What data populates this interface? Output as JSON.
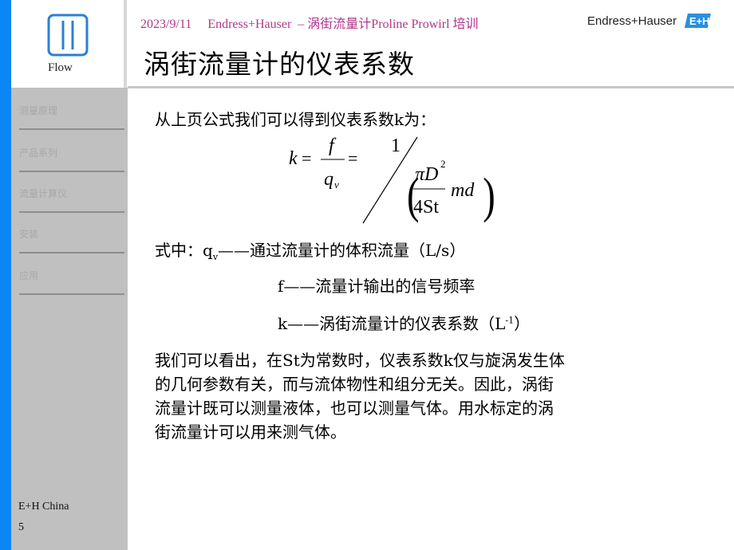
{
  "header": {
    "date": "2023/9/11",
    "course": "Endress+Hauser  – 涡街流量计Proline Prowirl 培训",
    "brand": "Endress+Hauser",
    "brand_logo_icon": "eh-logo-icon"
  },
  "logo": {
    "icon": "flow-icon",
    "label": "Flow"
  },
  "sidebar": {
    "items": [
      {
        "label": "测量原理"
      },
      {
        "label": "产品系列"
      },
      {
        "label": "流量计算仪"
      },
      {
        "label": "安装"
      },
      {
        "label": "应用"
      }
    ],
    "footer_org": "E+H China",
    "page_number": "5"
  },
  "slide": {
    "title": "涡街流量计的仪表系数",
    "intro": "从上页公式我们可以得到仪表系数k为：",
    "formula": {
      "lhs": "k",
      "eq": "=",
      "frac_num": "f",
      "frac_den_main": "q",
      "frac_den_sub": "v",
      "rhs_num": "1",
      "rhs_inner_num": "πD",
      "rhs_inner_num_sup": "2",
      "rhs_inner_den": "4St",
      "rhs_tail": "md",
      "lparen": "(",
      "rparen": ")"
    },
    "definitions": [
      {
        "prefix": "式中：",
        "symbol": "q",
        "symbol_sub": "v",
        "text": "——通过流量计的体积流量（L/s）"
      },
      {
        "symbol": "f",
        "text": "——流量计输出的信号频率"
      },
      {
        "symbol": "k",
        "text": "——涡街流量计的仪表系数（L",
        "sup": "-1",
        "suffix": "）"
      }
    ],
    "paragraph_lines": [
      "我们可以看出，在St为常数时，仪表系数k仅与旋涡发生体",
      "的几何参数有关，而与流体物性和组分无关。因此，涡街",
      "流量计既可以测量液体，也可以测量气体。用水标定的涡",
      "街流量计可以用来测气体。"
    ]
  },
  "colors": {
    "accent_blue": "#0a86f5",
    "header_magenta": "#b0368a",
    "sidebar_gray": "#c0c0c0"
  }
}
